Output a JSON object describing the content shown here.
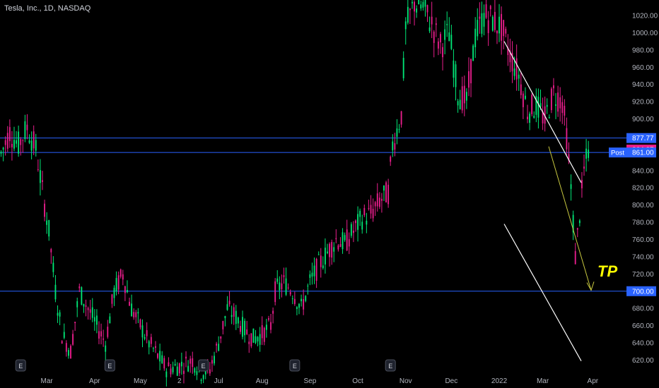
{
  "header": {
    "title": "Tesla, Inc., 1D, NASDAQ"
  },
  "chart_data": {
    "type": "candlestick",
    "symbol": "Tesla, Inc.",
    "interval": "1D",
    "exchange": "NASDAQ",
    "ylim": [
      604,
      1038
    ],
    "y_ticks": [
      620,
      640,
      660,
      680,
      700,
      720,
      740,
      760,
      780,
      800,
      820,
      840,
      860,
      880,
      900,
      920,
      940,
      960,
      980,
      1000,
      1020
    ],
    "x_ticks": [
      "Mar",
      "Apr",
      "May",
      "2",
      "Jul",
      "Aug",
      "Sep",
      "Oct",
      "Nov",
      "Dec",
      "2022",
      "Mar",
      "Apr"
    ],
    "x_tick_bars": [
      21,
      43,
      64,
      82,
      100,
      120,
      142,
      164,
      186,
      207,
      229,
      249,
      272
    ],
    "bar_count": 288,
    "anchors": [
      [
        0,
        860
      ],
      [
        4,
        885
      ],
      [
        8,
        870
      ],
      [
        12,
        890
      ],
      [
        16,
        865
      ],
      [
        20,
        800
      ],
      [
        22,
        770
      ],
      [
        25,
        700
      ],
      [
        28,
        650
      ],
      [
        32,
        630
      ],
      [
        36,
        700
      ],
      [
        40,
        680
      ],
      [
        44,
        660
      ],
      [
        48,
        640
      ],
      [
        52,
        700
      ],
      [
        56,
        720
      ],
      [
        60,
        680
      ],
      [
        64,
        660
      ],
      [
        68,
        640
      ],
      [
        72,
        625
      ],
      [
        76,
        610
      ],
      [
        80,
        612
      ],
      [
        84,
        615
      ],
      [
        88,
        620
      ],
      [
        92,
        605
      ],
      [
        96,
        610
      ],
      [
        100,
        640
      ],
      [
        104,
        680
      ],
      [
        108,
        670
      ],
      [
        112,
        655
      ],
      [
        116,
        645
      ],
      [
        120,
        650
      ],
      [
        124,
        660
      ],
      [
        126,
        700
      ],
      [
        130,
        710
      ],
      [
        134,
        700
      ],
      [
        138,
        680
      ],
      [
        142,
        710
      ],
      [
        146,
        730
      ],
      [
        150,
        745
      ],
      [
        154,
        760
      ],
      [
        158,
        755
      ],
      [
        162,
        770
      ],
      [
        166,
        785
      ],
      [
        170,
        790
      ],
      [
        174,
        805
      ],
      [
        178,
        815
      ],
      [
        180,
        870
      ],
      [
        184,
        905
      ],
      [
        186,
        1005
      ],
      [
        190,
        1035
      ],
      [
        194,
        1030
      ],
      [
        198,
        1010
      ],
      [
        202,
        985
      ],
      [
        206,
        1000
      ],
      [
        210,
        930
      ],
      [
        214,
        920
      ],
      [
        218,
        995
      ],
      [
        222,
        1020
      ],
      [
        226,
        1015
      ],
      [
        230,
        1005
      ],
      [
        234,
        975
      ],
      [
        238,
        950
      ],
      [
        242,
        910
      ],
      [
        246,
        915
      ],
      [
        250,
        900
      ],
      [
        254,
        930
      ],
      [
        258,
        920
      ],
      [
        260,
        880
      ],
      [
        262,
        820
      ],
      [
        264,
        740
      ],
      [
        266,
        790
      ],
      [
        268,
        840
      ],
      [
        270,
        864.37
      ]
    ],
    "last_price": 864.37,
    "horizontal_levels": [
      877.77,
      861.0,
      700.0
    ],
    "price_labels": [
      {
        "value": 877.77,
        "text": "877.77",
        "bg": "#2962ff"
      },
      {
        "value": 864.37,
        "text": "864.37",
        "bg": "#e91e8c"
      },
      {
        "value": 861.0,
        "text": "861.00",
        "bg": "#2962ff"
      },
      {
        "value": 700.0,
        "text": "700.00",
        "bg": "#2962ff"
      }
    ],
    "post_label": "Post",
    "annotation": {
      "text": "TP",
      "color": "#ffff00"
    },
    "event_badges": [
      {
        "bar": 9,
        "letter": "E"
      },
      {
        "bar": 50,
        "letter": "E"
      },
      {
        "bar": 93,
        "letter": "E"
      },
      {
        "bar": 135,
        "letter": "E"
      },
      {
        "bar": 179,
        "letter": "E"
      }
    ],
    "colors": {
      "up": "#00e676",
      "down": "#e91e8c",
      "level": "#2962ff",
      "axis_text": "#b2b5be",
      "channel": "#ffffff",
      "arrow": "#c8c840"
    }
  }
}
